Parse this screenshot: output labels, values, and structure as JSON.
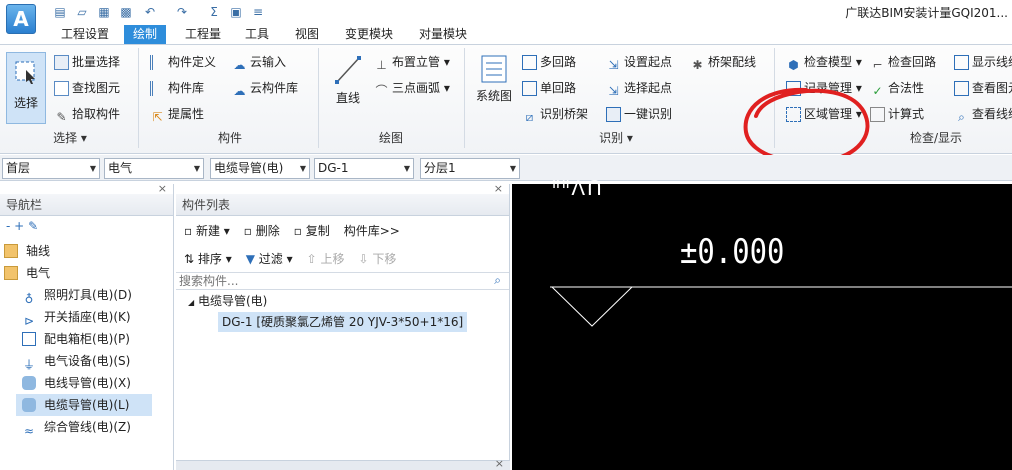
{
  "app": {
    "logo": "A",
    "title": "广联达BIM安装计量GQI201..."
  },
  "quick_access": [
    "save-icon",
    "open-icon",
    "new-icon",
    "bim-icon",
    "undo-icon",
    "redo-icon",
    "sum-icon",
    "disk-icon",
    "menu-icon"
  ],
  "quick_access_glyphs": [
    "▤",
    "▱",
    "▦",
    "▩",
    "↶",
    "↷",
    "Σ",
    "▣",
    "≡"
  ],
  "tabs": [
    "工程设置",
    "绘制",
    "工程量",
    "工具",
    "视图",
    "变更模块",
    "对量模块"
  ],
  "active_tab": "绘制",
  "ribbon": {
    "select": {
      "big": "选择",
      "items": [
        "批量选择",
        "查找图元",
        "拾取构件"
      ],
      "group": "选择 ▾"
    },
    "component": {
      "items": [
        "构件定义",
        "构件库",
        "提属性",
        "云输入",
        "云构件库"
      ],
      "group": "构件"
    },
    "draw": {
      "big": "直线",
      "items": [
        "布置立管 ▾",
        "三点画弧 ▾"
      ],
      "group": "绘图"
    },
    "identify": {
      "big": "系统图",
      "items": [
        "多回路",
        "单回路",
        "识别桥架",
        "设置起点",
        "选择起点",
        "一键识别",
        "桥架配线"
      ],
      "group": "识别 ▾"
    },
    "check": {
      "items": [
        "检查模型 ▾",
        "记录管理 ▾",
        "区域管理 ▾",
        "检查回路",
        "合法性",
        "计算式",
        "显示线缆",
        "查看图元",
        "查看线缆"
      ],
      "group": "检查/显示"
    }
  },
  "selectors": {
    "floor": "首层",
    "specialty": "电气",
    "type": "电缆导管(电)",
    "component": "DG-1",
    "layer": "分层1"
  },
  "nav": {
    "title": "导航栏",
    "items": [
      {
        "label": "轴线",
        "icon": "folder-icon"
      },
      {
        "label": "电气",
        "icon": "folder-open-icon"
      },
      {
        "label": "照明灯具(电)(D)",
        "icon": "lamp-icon"
      },
      {
        "label": "开关插座(电)(K)",
        "icon": "switch-icon"
      },
      {
        "label": "配电箱柜(电)(P)",
        "icon": "cabinet-icon"
      },
      {
        "label": "电气设备(电)(S)",
        "icon": "device-icon"
      },
      {
        "label": "电线导管(电)(X)",
        "icon": "wire-icon"
      },
      {
        "label": "电缆导管(电)(L)",
        "icon": "cable-icon"
      },
      {
        "label": "综合管线(电)(Z)",
        "icon": "pipeline-icon"
      }
    ],
    "selected": 7
  },
  "list": {
    "title": "构件列表",
    "toolbar1": [
      "新建 ▾",
      "删除",
      "复制",
      "构件库>>"
    ],
    "toolbar2": [
      "排序 ▾",
      "过滤 ▾",
      "上移",
      "下移"
    ],
    "search_placeholder": "搜索构件...",
    "tree_root": "电缆导管(电)",
    "tree_child": "DG-1 [硬质聚氯乙烯管 20 YJV-3*50+1*16]"
  },
  "canvas": {
    "elevation": "±0.000",
    "partial_text": "ᐦᐦᐱᑎ"
  },
  "colors": {
    "accent": "#2e8ddb",
    "canvas_bg": "#000000",
    "annotation_circle": "#e02020"
  }
}
